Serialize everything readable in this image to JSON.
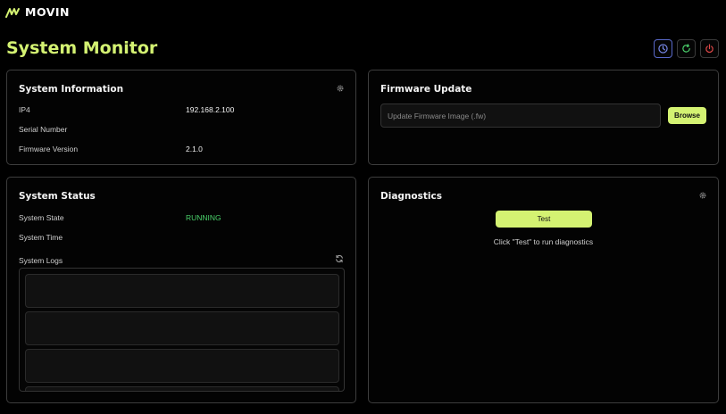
{
  "app": {
    "brand_name": "MOVIN",
    "page_title": "System Monitor"
  },
  "top_actions": [
    "clock-icon",
    "refresh-icon",
    "power-icon"
  ],
  "colors": {
    "accent": "#d4f272",
    "running": "#4ad06a",
    "clock_border": "#5868c8",
    "power": "#e04848",
    "refresh": "#4ad06a"
  },
  "system_information": {
    "title": "System Information",
    "rows": [
      {
        "label": "IP4",
        "value": "192.168.2.100"
      },
      {
        "label": "Serial Number",
        "value": ""
      },
      {
        "label": "Firmware Version",
        "value": "2.1.0"
      }
    ]
  },
  "firmware_update": {
    "title": "Firmware Update",
    "placeholder": "Update Firmware Image (.fw)",
    "value": "",
    "browse_label": "Browse"
  },
  "system_status": {
    "title": "System Status",
    "rows": [
      {
        "label": "System State",
        "value": "RUNNING"
      },
      {
        "label": "System Time",
        "value": ""
      }
    ],
    "logs_label": "System Logs",
    "log_entries": [
      "",
      "",
      "",
      ""
    ]
  },
  "diagnostics": {
    "title": "Diagnostics",
    "test_label": "Test",
    "message": "Click \"Test\" to run diagnostics"
  }
}
